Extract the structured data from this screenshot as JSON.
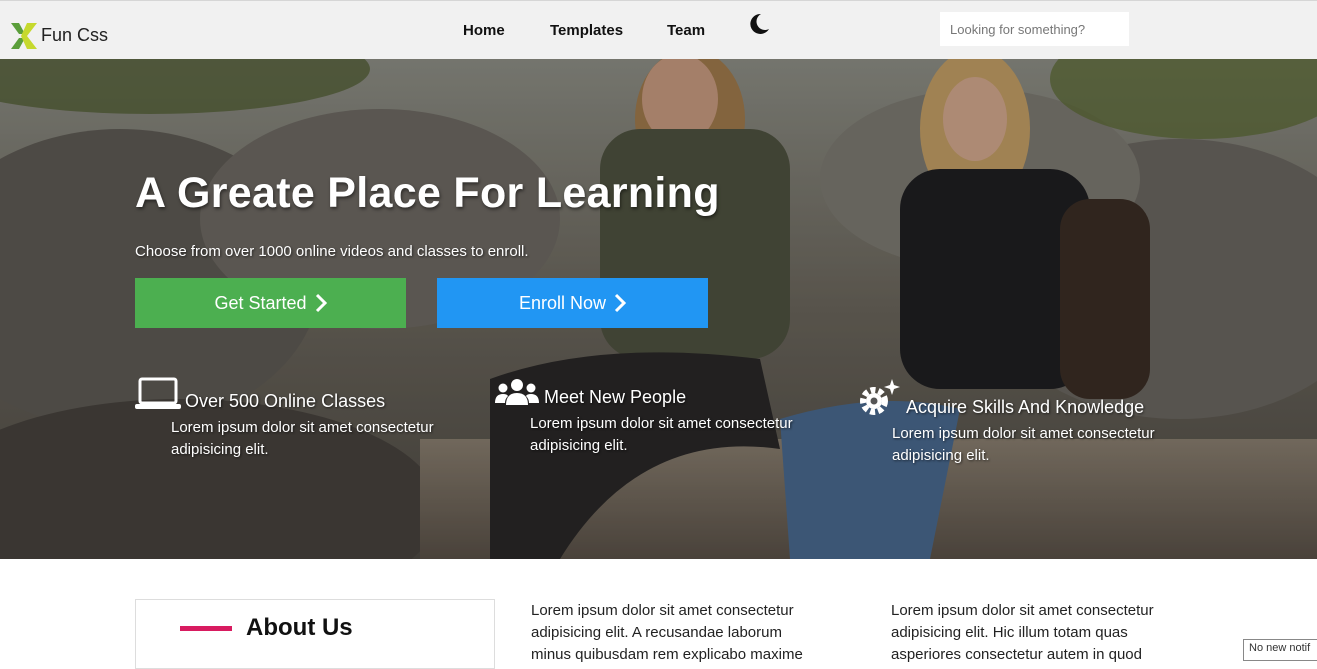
{
  "brand": {
    "name": "Fun Css"
  },
  "nav": {
    "links": [
      "Home",
      "Templates",
      "Team"
    ],
    "search_placeholder": "Looking for something?"
  },
  "hero": {
    "title": "A Greate Place For Learning",
    "subtitle": "Choose from over 1000 online videos and classes to enroll.",
    "primary_button": "Get Started",
    "secondary_button": "Enroll Now",
    "features": [
      {
        "icon": "laptop-icon",
        "title": "Over 500 Online Classes",
        "text": "Lorem ipsum dolor sit amet consectetur adipisicing elit."
      },
      {
        "icon": "people-icon",
        "title": "Meet New People",
        "text": "Lorem ipsum dolor sit amet consectetur adipisicing elit."
      },
      {
        "icon": "gears-icon",
        "title": "Acquire Skills And Knowledge",
        "text": "Lorem ipsum dolor sit amet consectetur adipisicing elit."
      }
    ]
  },
  "about": {
    "title": "About Us",
    "columns": [
      "Lorem ipsum dolor sit amet consectetur adipisicing elit. A recusandae laborum minus quibusdam rem explicabo maxime",
      "Lorem ipsum dolor sit amet consectetur adipisicing elit. Hic illum totam quas asperiores consectetur autem in quod"
    ]
  },
  "notification": "No new notif",
  "colors": {
    "nav_bg": "#f1f1f1",
    "green_button": "#4caf50",
    "blue_button": "#2196f3",
    "accent_bar": "#d81b60"
  }
}
